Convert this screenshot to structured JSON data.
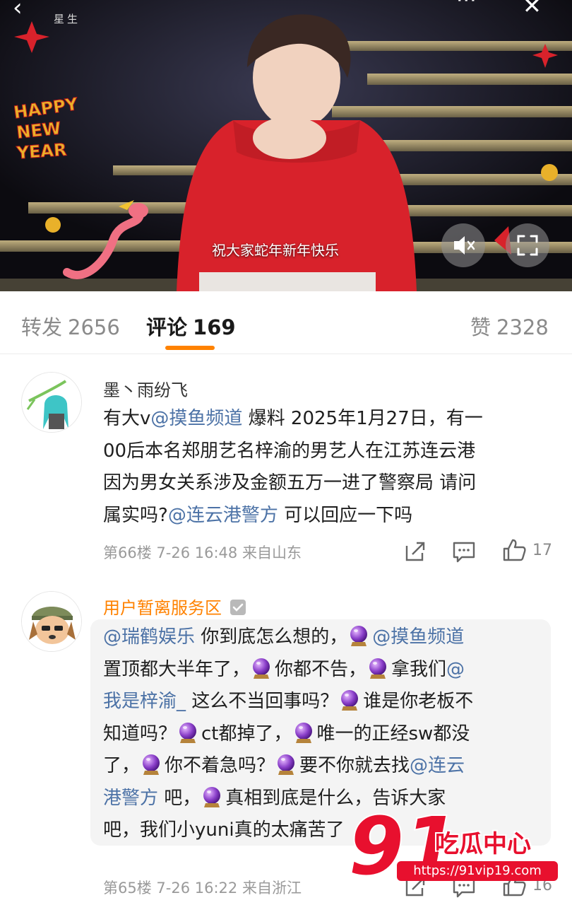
{
  "video": {
    "brand": "星生",
    "subtitle": "祝大家蛇年新年快乐",
    "sticker_text": [
      "HAPPY",
      "NEW",
      "YEAR"
    ],
    "icons": {
      "back": "back-icon",
      "more": "more-icon",
      "close": "close-icon",
      "mute": "mute-icon",
      "fullscreen": "fullscreen-icon"
    },
    "more_glyph": "···",
    "close_glyph": "✕"
  },
  "tabs": [
    {
      "label": "转发",
      "count": "2656"
    },
    {
      "label": "评论",
      "count": "169"
    },
    {
      "label": "赞",
      "count": "2328"
    }
  ],
  "comments": [
    {
      "username": "墨丶雨纷飞",
      "text_lines": [
        [
          {
            "t": "有大v"
          },
          {
            "m": "@摸鱼频道"
          },
          {
            "t": " 爆料 2025年1月27日，有一"
          }
        ],
        [
          {
            "t": "00后本名郑朋艺名梓渝的男艺人在江苏连云港"
          }
        ],
        [
          {
            "t": "因为男女关系涉及金额五万一进了警察局 请问"
          }
        ],
        [
          {
            "t": "属实吗?"
          },
          {
            "m": "@连云港警方"
          },
          {
            "t": " 可以回应一下吗"
          }
        ]
      ],
      "floor": "第66楼",
      "time": "7-26 16:48",
      "location": "来自山东",
      "likes": "17"
    },
    {
      "username": "用户暂离服务区",
      "text_lines": [
        [
          {
            "m": "@瑞鹤娱乐"
          },
          {
            "t": " 你到底怎么想的，"
          },
          {
            "e": "crystal-ball"
          },
          {
            "m": "@摸鱼频道"
          }
        ],
        [
          {
            "t": "置顶都大半年了，"
          },
          {
            "e": "crystal-ball"
          },
          {
            "t": "你都不告，"
          },
          {
            "e": "crystal-ball"
          },
          {
            "t": "拿我们"
          },
          {
            "m": "@"
          }
        ],
        [
          {
            "m": "我是梓渝_"
          },
          {
            "t": " 这么不当回事吗？"
          },
          {
            "e": "crystal-ball"
          },
          {
            "t": "谁是你老板不"
          }
        ],
        [
          {
            "t": "知道吗？"
          },
          {
            "e": "crystal-ball"
          },
          {
            "t": "ct都掉了，"
          },
          {
            "e": "crystal-ball"
          },
          {
            "t": "唯一的正经sw都没"
          }
        ],
        [
          {
            "t": "了，"
          },
          {
            "e": "crystal-ball"
          },
          {
            "t": "你不着急吗？"
          },
          {
            "e": "crystal-ball"
          },
          {
            "t": "要不你就去找"
          },
          {
            "m": "@连云"
          }
        ],
        [
          {
            "m": "港警方"
          },
          {
            "t": " 吧，"
          },
          {
            "e": "crystal-ball"
          },
          {
            "t": "真相到底是什么，告诉大家"
          }
        ],
        [
          {
            "t": "吧，我们小yuni真的太痛苦了"
          }
        ]
      ],
      "floor": "第65楼",
      "time": "7-26 16:22",
      "location": "来自浙江",
      "likes": "16"
    }
  ],
  "watermark": {
    "number": "91",
    "title": "吃瓜中心",
    "url": "https://91vip19.com"
  },
  "colors": {
    "accent": "#ff8200",
    "mention": "#4c72a6",
    "watermark": "#e8102e"
  }
}
